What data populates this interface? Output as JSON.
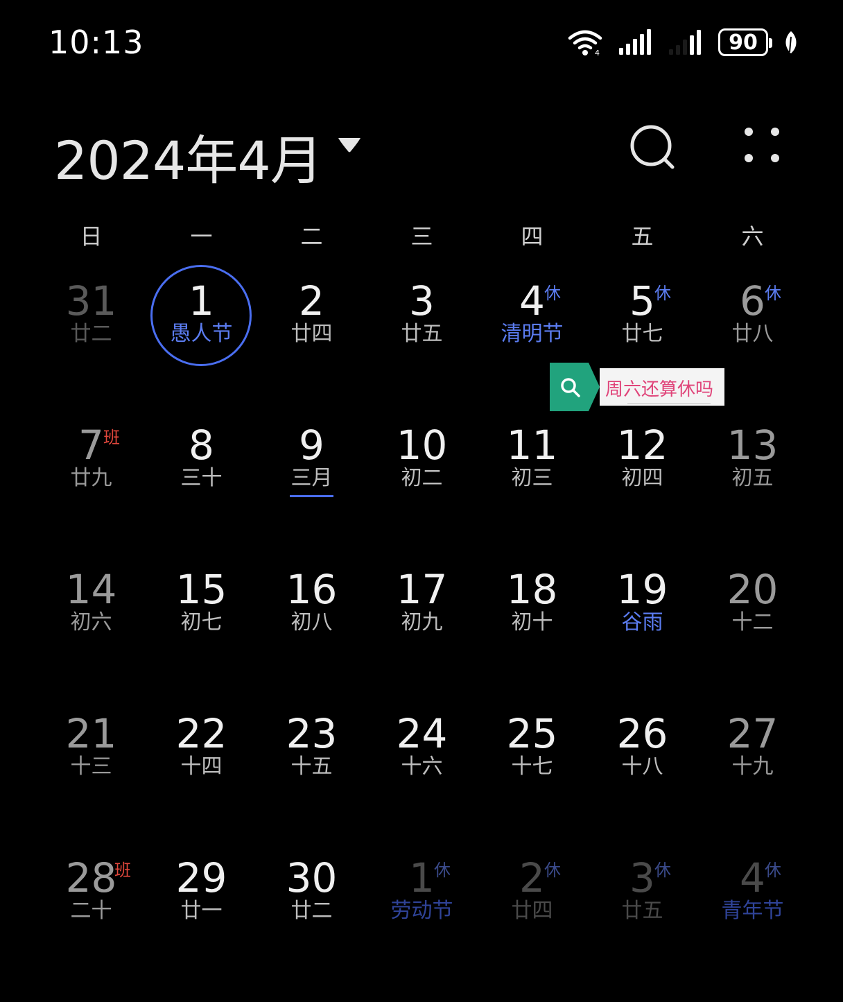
{
  "status_bar": {
    "time": "10:13",
    "battery": "90",
    "icons": [
      "wifi-icon",
      "signal-icon",
      "signal-icon-secondary",
      "battery-icon",
      "leaf-icon"
    ]
  },
  "header": {
    "month_title": "2024年4月",
    "icons": [
      "caret-down-icon",
      "search-icon",
      "more-icon"
    ]
  },
  "weekdays": [
    "日",
    "一",
    "二",
    "三",
    "四",
    "五",
    "六"
  ],
  "search_suggestion": {
    "text": "周六还算休吗",
    "icon": "search-icon",
    "colors": {
      "tag": "#21a37d",
      "text": "#e0457a"
    }
  },
  "colors": {
    "accent": "#4a6ef0",
    "rest_badge": "#5b7cf0",
    "work_badge": "#e0473c"
  },
  "weeks": [
    [
      {
        "num": "31",
        "lunar": "廿二",
        "other": "prev"
      },
      {
        "num": "1",
        "lunar": "愚人节",
        "today": true,
        "festival": true
      },
      {
        "num": "2",
        "lunar": "廿四"
      },
      {
        "num": "3",
        "lunar": "廿五"
      },
      {
        "num": "4",
        "lunar": "清明节",
        "badge": "休",
        "festival": true
      },
      {
        "num": "5",
        "lunar": "廿七",
        "badge": "休"
      },
      {
        "num": "6",
        "lunar": "廿八",
        "badge": "休"
      }
    ],
    [
      {
        "num": "7",
        "lunar": "廿九",
        "badge": "班",
        "work": true
      },
      {
        "num": "8",
        "lunar": "三十"
      },
      {
        "num": "9",
        "lunar": "三月",
        "underline": true
      },
      {
        "num": "10",
        "lunar": "初二"
      },
      {
        "num": "11",
        "lunar": "初三"
      },
      {
        "num": "12",
        "lunar": "初四"
      },
      {
        "num": "13",
        "lunar": "初五"
      }
    ],
    [
      {
        "num": "14",
        "lunar": "初六"
      },
      {
        "num": "15",
        "lunar": "初七"
      },
      {
        "num": "16",
        "lunar": "初八"
      },
      {
        "num": "17",
        "lunar": "初九"
      },
      {
        "num": "18",
        "lunar": "初十"
      },
      {
        "num": "19",
        "lunar": "谷雨",
        "festival": true
      },
      {
        "num": "20",
        "lunar": "十二"
      }
    ],
    [
      {
        "num": "21",
        "lunar": "十三"
      },
      {
        "num": "22",
        "lunar": "十四"
      },
      {
        "num": "23",
        "lunar": "十五"
      },
      {
        "num": "24",
        "lunar": "十六"
      },
      {
        "num": "25",
        "lunar": "十七"
      },
      {
        "num": "26",
        "lunar": "十八"
      },
      {
        "num": "27",
        "lunar": "十九"
      }
    ],
    [
      {
        "num": "28",
        "lunar": "二十",
        "badge": "班",
        "work": true
      },
      {
        "num": "29",
        "lunar": "廿一"
      },
      {
        "num": "30",
        "lunar": "廿二"
      },
      {
        "num": "1",
        "lunar": "劳动节",
        "badge": "休",
        "other": "next",
        "festival": true
      },
      {
        "num": "2",
        "lunar": "廿四",
        "badge": "休",
        "other": "next"
      },
      {
        "num": "3",
        "lunar": "廿五",
        "badge": "休",
        "other": "next"
      },
      {
        "num": "4",
        "lunar": "青年节",
        "badge": "休",
        "other": "next",
        "festival": true
      }
    ]
  ]
}
